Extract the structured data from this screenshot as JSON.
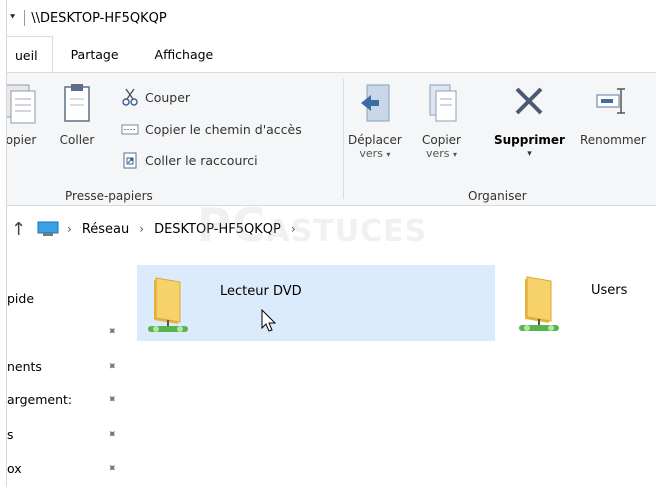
{
  "window": {
    "title": "\\\\DESKTOP-HF5QKQP",
    "quick_access_glyph": "⯆"
  },
  "ribbon_tabs": [
    {
      "label": "ueil",
      "active": true
    },
    {
      "label": "Partage",
      "active": false
    },
    {
      "label": "Affichage",
      "active": false
    }
  ],
  "ribbon": {
    "clipboard": {
      "label": "Presse-papiers",
      "copy": "opier",
      "paste": "Coller",
      "cut": "Couper",
      "copy_path": "Copier le chemin d'accès",
      "paste_shortcut": "Coller le raccourci"
    },
    "organize": {
      "label": "Organiser",
      "move_to_line1": "Déplacer",
      "move_to_line2": "vers",
      "copy_to_line1": "Copier",
      "copy_to_line2": "vers",
      "delete": "Supprimer",
      "rename": "Renommer"
    }
  },
  "address": {
    "crumbs": [
      "Réseau",
      "DESKTOP-HF5QKQP"
    ],
    "separator": "›",
    "up_glyph": "↑"
  },
  "nav": {
    "items": [
      {
        "label": "pide",
        "pinned": false
      },
      {
        "label": "",
        "pinned": true
      },
      {
        "label": "nents",
        "pinned": true
      },
      {
        "label": "argement:",
        "pinned": true
      },
      {
        "label": "s",
        "pinned": true
      },
      {
        "label": "ox",
        "pinned": true
      }
    ],
    "pin_glyph": "📌"
  },
  "content": {
    "items": [
      {
        "name": "Lecteur DVD",
        "selected": true
      },
      {
        "name": "Users",
        "selected": false
      }
    ]
  },
  "watermark": {
    "text": "PC",
    "text2": "ASTUCES"
  },
  "colors": {
    "selection": "#dcebfc",
    "ribbon_bg": "#f5f6f7",
    "folder": "#f0c04a",
    "network": "#4caf50"
  }
}
